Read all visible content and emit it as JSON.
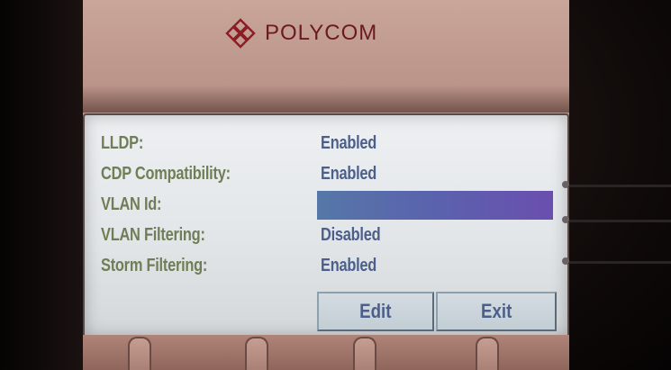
{
  "brand": {
    "logo_text": "POLYCOM"
  },
  "settings": {
    "rows": [
      {
        "label": "LLDP:",
        "value": "Enabled"
      },
      {
        "label": "CDP Compatibility:",
        "value": "Enabled"
      },
      {
        "label": "VLAN Id:",
        "value": ""
      },
      {
        "label": "VLAN Filtering:",
        "value": "Disabled"
      },
      {
        "label": "Storm Filtering:",
        "value": "Enabled"
      }
    ],
    "selected_row": "VLAN Id:"
  },
  "softkeys": {
    "edit_label": "Edit",
    "exit_label": "Exit"
  },
  "colors": {
    "label_text": "#6f7e56",
    "value_text": "#4b5f8a",
    "selection": "#5a62ad",
    "brand": "#6b1a1f"
  }
}
